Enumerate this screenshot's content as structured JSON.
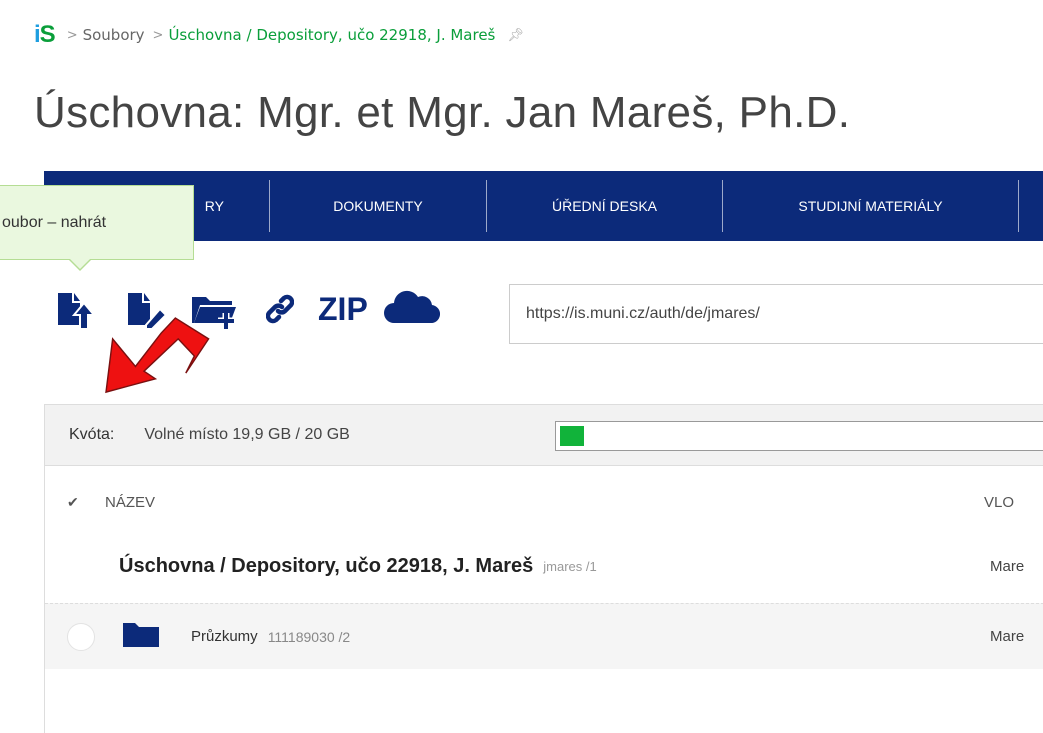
{
  "breadcrumb": {
    "logo_i": "i",
    "logo_s": "S",
    "items": [
      "Soubory",
      "Úschovna / Depository, učo 22918, J. Mareš"
    ],
    "separator": ">"
  },
  "page_title": "Úschovna: Mgr. et Mgr. Jan Mareš, Ph.D.",
  "nav": {
    "items": [
      "RY",
      "DOKUMENTY",
      "ÚŘEDNÍ DESKA",
      "STUDIJNÍ MATERIÁLY"
    ]
  },
  "tooltip": {
    "text": "oubor – nahrát"
  },
  "toolbar": {
    "zip_label": "ZIP",
    "url_value": "https://is.muni.cz/auth/de/jmares/"
  },
  "quota": {
    "label": "Kvóta:",
    "text": "Volné místo 19,9 GB / 20 GB",
    "used_fraction": 0.005
  },
  "table": {
    "header_name": "NÁZEV",
    "header_vlo": "VLO",
    "folder_title": "Úschovna / Depository, učo 22918, J. Mareš",
    "folder_meta": "jmares /1",
    "folder_owner": "Mare",
    "rows": [
      {
        "name": "Průzkumy",
        "meta": "111189030 /2",
        "owner": "Mare"
      }
    ]
  },
  "colors": {
    "nav_bg": "#0c2a7a",
    "accent_green": "#0a9e3a",
    "tooltip_bg": "#eaf8df",
    "quota_fill": "#11b33a",
    "annotation_arrow": "#ee1111"
  },
  "icons": [
    "file-upload-icon",
    "file-edit-icon",
    "folder-add-icon",
    "link-icon",
    "cloud-icon",
    "folder-icon",
    "check-icon",
    "pin-icon"
  ]
}
